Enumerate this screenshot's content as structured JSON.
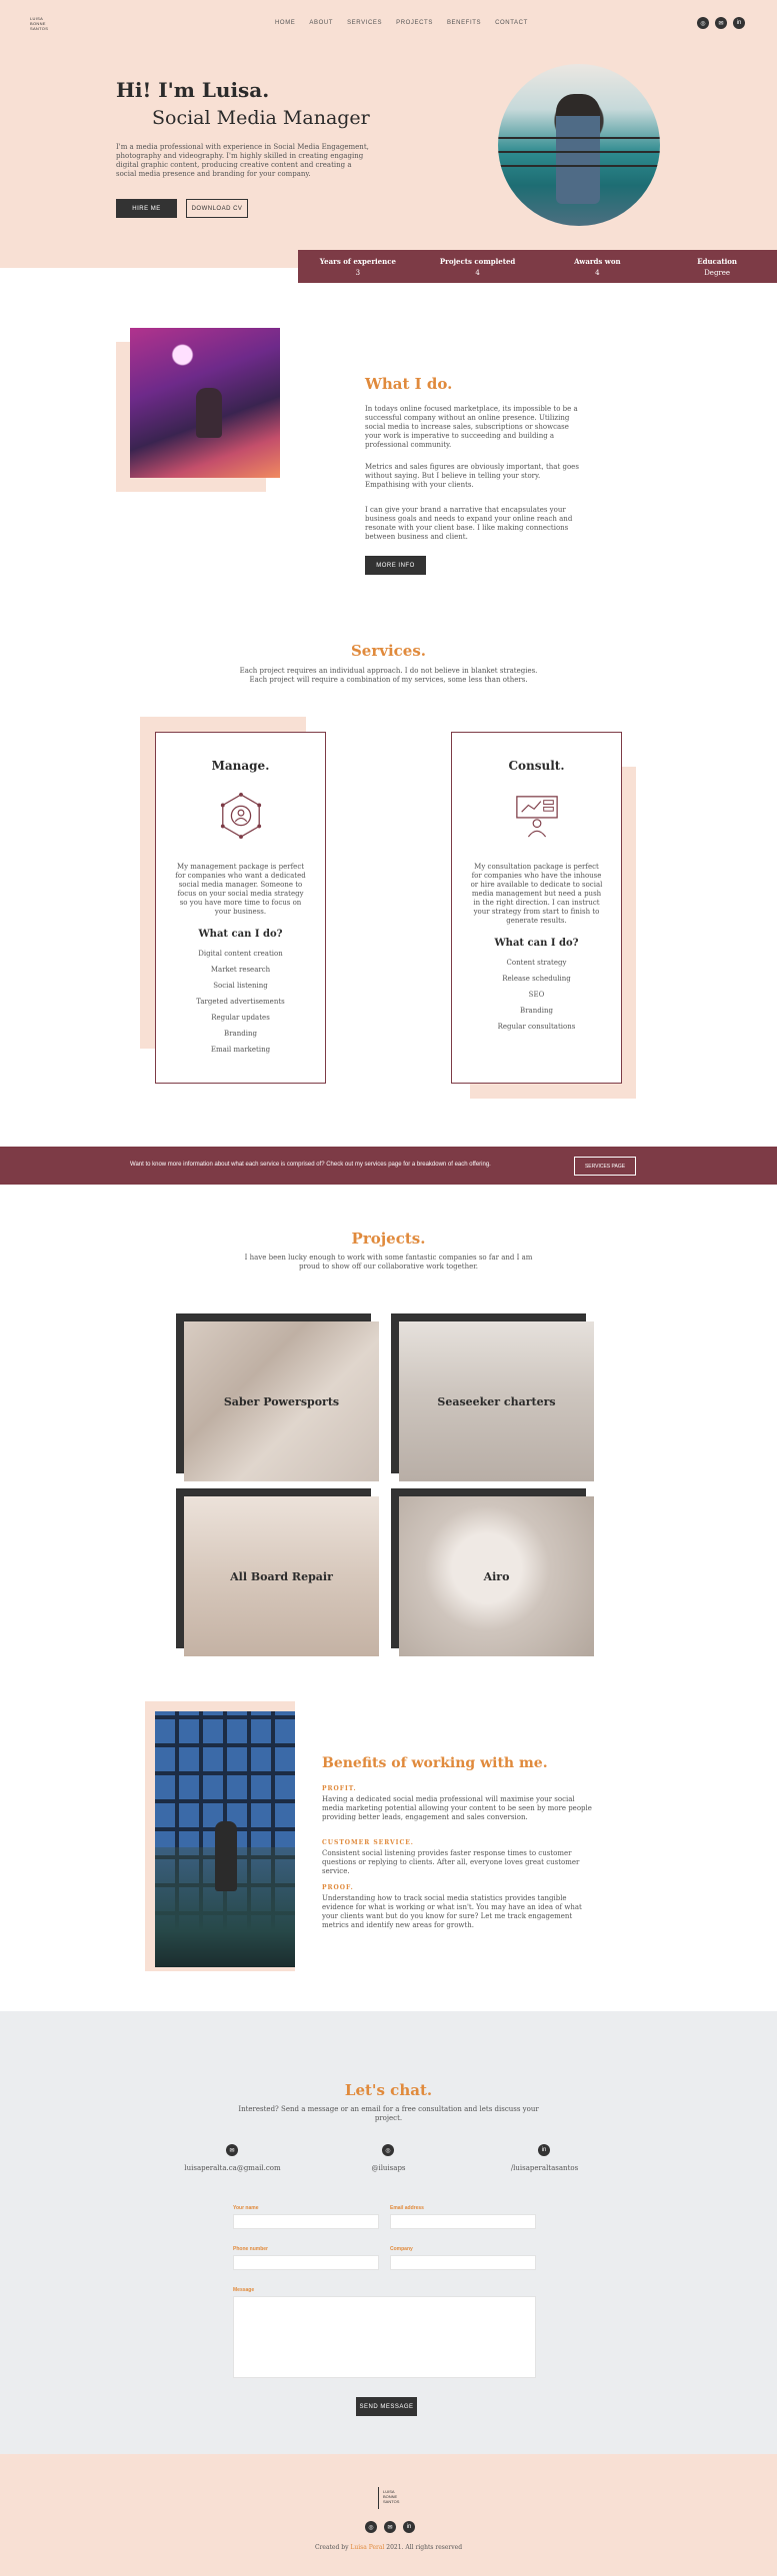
{
  "header": {
    "logo_lines": [
      "LUISA",
      "BONNE",
      "SANTOS"
    ],
    "nav": [
      "HOME",
      "ABOUT",
      "SERVICES",
      "PROJECTS",
      "BENEFITS",
      "CONTACT"
    ],
    "social_icons": [
      "instagram-icon",
      "email-icon",
      "linkedin-icon"
    ]
  },
  "hero": {
    "greeting": "Hi! I'm Luisa.",
    "role": "Social Media Manager",
    "intro": "I'm a media professional with experience in Social Media Engagement, photography and videography. I'm highly skilled in creating engaging digital graphic content, producing creative content and creating a social media presence and branding for your company.",
    "hire_label": "HIRE ME",
    "cv_label": "DOWNLOAD CV"
  },
  "stats": [
    {
      "label": "Years of experience",
      "value": "3"
    },
    {
      "label": "Projects completed",
      "value": "4"
    },
    {
      "label": "Awards won",
      "value": "4"
    },
    {
      "label": "Education",
      "value": "Degree"
    }
  ],
  "what": {
    "title": "What I do.",
    "p1": "In todays online focused marketplace, its impossible to be a successful company without an online presence. Utilizing social media to increase sales, subscriptions or showcase your work is imperative to succeeding and building a professional community.",
    "p2": "Metrics and sales figures are obviously important, that goes without saying. But I believe in telling your story. Empathising with your clients.",
    "p3": "I can give your brand a narrative that encapsulates your business goals and needs to expand your online reach and resonate with your client base. I like making connections between business and client.",
    "button": "MORE INFO"
  },
  "services": {
    "title": "Services.",
    "subtitle1": "Each project requires an individual approach. I do not believe in blanket strategies.",
    "subtitle2": "Each project will require a combination of my services, some less than others.",
    "cards": [
      {
        "title": "Manage.",
        "icon": "network-user-icon",
        "desc": "My management package is perfect for companies who want a dedicated social media manager. Someone to focus on your social media strategy so you have more time to focus on your business.",
        "what": "What can I do?",
        "items": [
          "Digital content creation",
          "Market research",
          "Social listening",
          "Targeted advertisements",
          "Regular updates",
          "Branding",
          "Email marketing"
        ]
      },
      {
        "title": "Consult.",
        "icon": "presentation-icon",
        "desc": "My consultation package is perfect for companies who have the inhouse or hire available to dedicate to social media management but need a push in the right direction. I can instruct your strategy from start to finish to generate results.",
        "what": "What can I do?",
        "items": [
          "Content strategy",
          "Release scheduling",
          "SEO",
          "Branding",
          "Regular consultations"
        ]
      }
    ]
  },
  "banner": {
    "text": "Want to know more information about what each service is comprised of? Check out my services page for a breakdown of each offering.",
    "button": "SERVICES PAGE"
  },
  "projects": {
    "title": "Projects.",
    "subtitle1": "I have been lucky enough to work with some fantastic companies so far and I am",
    "subtitle2": "proud to show off our collaborative work together.",
    "items": [
      "Saber Powersports",
      "Seaseeker charters",
      "All Board Repair",
      "Airo"
    ]
  },
  "benefits": {
    "title": "Benefits of working with me.",
    "items": [
      {
        "heading": "PROFIT.",
        "text": "Having a dedicated social media professional will maximise your social media marketing potential allowing your content to be seen by more people providing better leads, engagement and sales conversion."
      },
      {
        "heading": "CUSTOMER SERVICE.",
        "text": "Consistent social listening provides faster response times to customer questions or replying to clients. After all, everyone loves great customer service."
      },
      {
        "heading": "PROOF.",
        "text": "Understanding how to track social media statistics provides tangible evidence for what is working or what isn't. You may have an idea of what your clients want but do you know for sure? Let me track engagement metrics and identify new areas for growth."
      }
    ]
  },
  "contact": {
    "title": "Let's chat.",
    "sub1": "Interested? Send a message or an email for a free consultation and lets discuss your",
    "sub2": "project.",
    "channels": [
      {
        "icon": "email-icon",
        "text": "luisaperalta.ca@gmail.com"
      },
      {
        "icon": "instagram-icon",
        "text": "@iluisaps"
      },
      {
        "icon": "linkedin-icon",
        "text": "/luisaperaltasantos"
      }
    ],
    "fields": {
      "name": "Your name",
      "email": "Email address",
      "phone": "Phone number",
      "company": "Company",
      "message": "Message"
    },
    "send": "SEND MESSAGE"
  },
  "footer": {
    "created_prefix": "Created by ",
    "created_link": "Luisa Peral",
    "created_suffix": " 2021. All rights reserved"
  },
  "colors": {
    "accent": "#e08a3c",
    "wine": "#7d3b46",
    "peach": "#f8e0d4",
    "dark": "#333333"
  }
}
